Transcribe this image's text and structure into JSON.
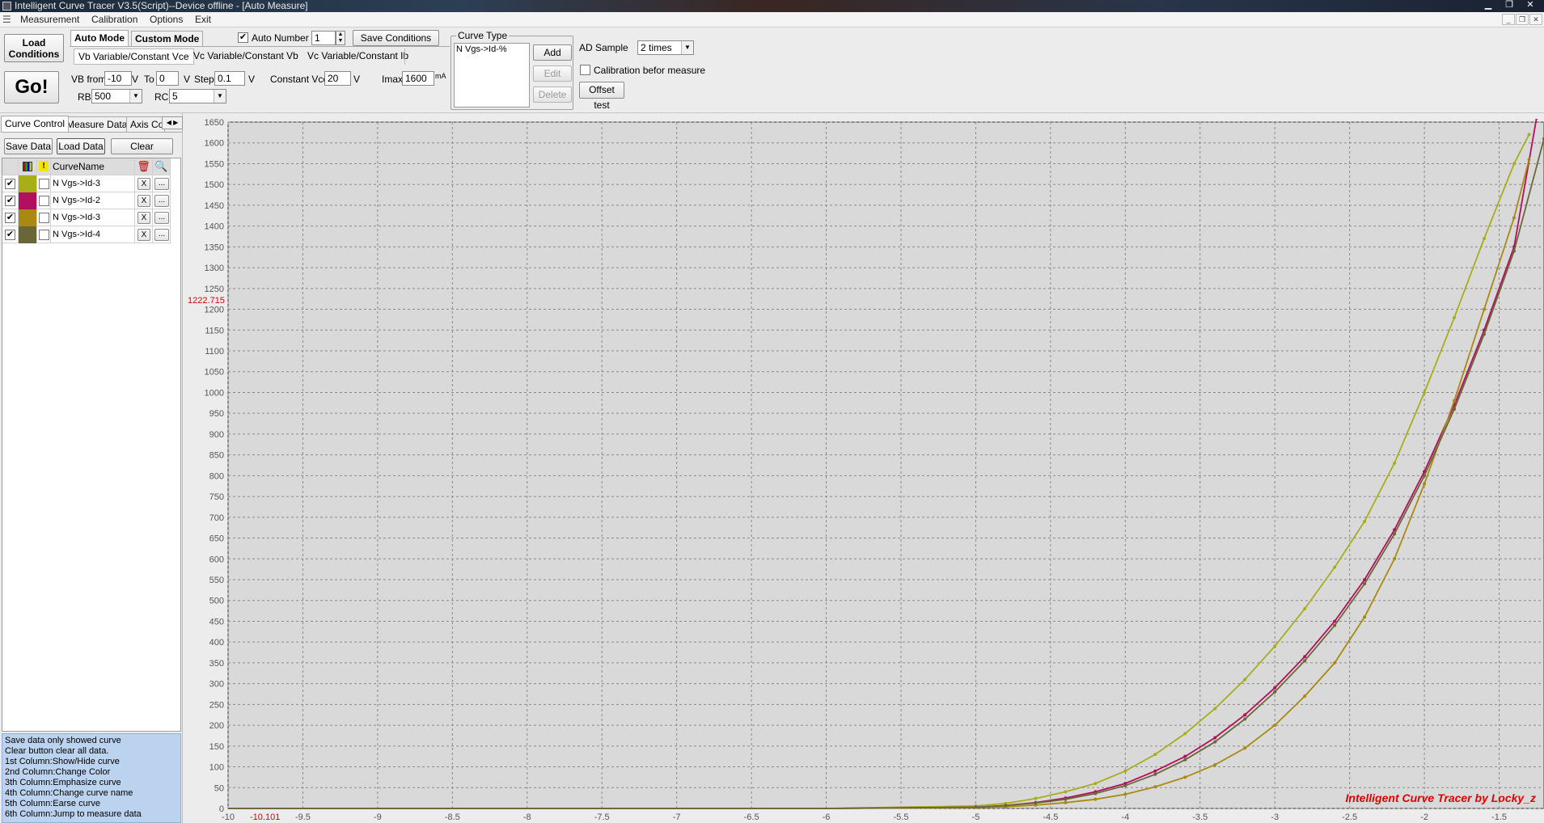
{
  "window": {
    "title": "Intelligent Curve Tracer V3.5(Script)--Device offline - [Auto Measure]"
  },
  "menu": [
    "Measurement",
    "Calibration",
    "Options",
    "Exit"
  ],
  "toolbar": {
    "load_conditions": "Load Conditions",
    "go": "Go!",
    "mode_tabs": [
      "Auto Mode",
      "Custom Mode"
    ],
    "auto_number_label": "Auto Number",
    "auto_number_checked": true,
    "auto_number_value": "1",
    "save_conditions": "Save Conditions",
    "sub_tabs": [
      "Vb Variable/Constant Vce",
      "Vc Variable/Constant Vb",
      "Vc Variable/Constant Ib"
    ],
    "vb_from_label": "VB from",
    "vb_from": "-10",
    "v1": "V",
    "to_label": "To",
    "to": "0",
    "v2": "V",
    "step_label": "Step",
    "step": "0.1",
    "v3": "V",
    "constant_vce_label": "Constant Vce",
    "constant_vce": "20",
    "v4": "V",
    "imax_label": "Imax",
    "imax": "1600",
    "imax_unit": "mA",
    "rb_label": "RB",
    "rb": "500",
    "rc_label": "RC",
    "rc": "5"
  },
  "curve_type": {
    "legend": "Curve Type",
    "items": [
      "N Vgs->Id-%"
    ],
    "add": "Add",
    "edit": "Edit",
    "delete": "Delete"
  },
  "ad_sample": {
    "label": "AD Sample",
    "value": "2 times",
    "calibration_label": "Calibration befor measure",
    "calibration_checked": false,
    "offset_test": "Offset test"
  },
  "left_tabs": [
    "Curve Control",
    "Measure Data",
    "Axis Co"
  ],
  "left_buttons": {
    "save": "Save Data",
    "load": "Load Data",
    "clear": "Clear"
  },
  "curve_table": {
    "header": "CurveName",
    "rows": [
      {
        "visible": true,
        "color": "#a8ad1a",
        "emphasize": false,
        "name": "N Vgs->Id-3"
      },
      {
        "visible": true,
        "color": "#b0105e",
        "emphasize": false,
        "name": "N Vgs->Id-2"
      },
      {
        "visible": true,
        "color": "#a88a12",
        "emphasize": false,
        "name": "N Vgs->Id-3"
      },
      {
        "visible": true,
        "color": "#6b6638",
        "emphasize": false,
        "name": "N Vgs->Id-4"
      }
    ],
    "erase": "X",
    "more": "..."
  },
  "help_text": [
    " Save data only showed curve",
    " Clear button clear all data.",
    "1st Column:Show/Hide curve",
    "2nd Column:Change Color",
    "3th Column:Emphasize curve",
    "4th Column:Change curve name",
    "5th Column:Earse curve",
    "6th Column:Jump to measure data"
  ],
  "chart_data": {
    "type": "line",
    "xlabel": "",
    "ylabel": "",
    "xlim": [
      -10,
      -1.2
    ],
    "ylim": [
      0,
      1650
    ],
    "x_ticks": [
      -10,
      -9.5,
      -9,
      -8.5,
      -8,
      -7.5,
      -7,
      -6.5,
      -6,
      -5.5,
      -5,
      -4.5,
      -4,
      -3.5,
      -3,
      -2.5,
      -2,
      -1.5
    ],
    "y_ticks": [
      0,
      50,
      100,
      150,
      200,
      250,
      300,
      350,
      400,
      450,
      500,
      550,
      600,
      650,
      700,
      750,
      800,
      850,
      900,
      950,
      1000,
      1050,
      1100,
      1150,
      1200,
      1250,
      1300,
      1350,
      1400,
      1450,
      1500,
      1550,
      1600,
      1650
    ],
    "grid": true,
    "cursor_y_label": "1222.715",
    "cursor_x_label": "-10.101",
    "watermark": "Intelligent Curve Tracer by Locky_z",
    "series": [
      {
        "color": "#a8ad1a",
        "x": [
          -10,
          -6,
          -5,
          -4.8,
          -4.6,
          -4.4,
          -4.2,
          -4.0,
          -3.8,
          -3.6,
          -3.4,
          -3.2,
          -3.0,
          -2.8,
          -2.6,
          -2.4,
          -2.2,
          -2.0,
          -1.8,
          -1.6,
          -1.4,
          -1.3
        ],
        "y": [
          0,
          0,
          6,
          12,
          24,
          40,
          60,
          90,
          130,
          180,
          240,
          310,
          390,
          480,
          580,
          690,
          830,
          1000,
          1180,
          1370,
          1550,
          1620
        ]
      },
      {
        "color": "#b0105e",
        "x": [
          -10,
          -6,
          -5,
          -4.8,
          -4.6,
          -4.4,
          -4.2,
          -4.0,
          -3.8,
          -3.6,
          -3.4,
          -3.2,
          -3.0,
          -2.8,
          -2.6,
          -2.4,
          -2.2,
          -2.0,
          -1.8,
          -1.6,
          -1.4,
          -1.25
        ],
        "y": [
          0,
          0,
          3,
          7,
          14,
          25,
          40,
          60,
          90,
          125,
          170,
          225,
          290,
          365,
          450,
          550,
          670,
          810,
          970,
          1150,
          1350,
          1660
        ]
      },
      {
        "color": "#a88a12",
        "x": [
          -10,
          -6,
          -5,
          -4.8,
          -4.6,
          -4.4,
          -4.2,
          -4.0,
          -3.8,
          -3.6,
          -3.4,
          -3.2,
          -3.0,
          -2.8,
          -2.6,
          -2.4,
          -2.2,
          -2.0,
          -1.8,
          -1.6,
          -1.4,
          -1.3
        ],
        "y": [
          0,
          0,
          2,
          4,
          8,
          14,
          22,
          34,
          52,
          75,
          105,
          145,
          200,
          270,
          350,
          460,
          600,
          780,
          980,
          1200,
          1420,
          1560
        ]
      },
      {
        "color": "#6b6638",
        "x": [
          -10,
          -6,
          -5,
          -4.8,
          -4.6,
          -4.4,
          -4.2,
          -4.0,
          -3.8,
          -3.6,
          -3.4,
          -3.2,
          -3.0,
          -2.8,
          -2.6,
          -2.4,
          -2.2,
          -2.0,
          -1.8,
          -1.6,
          -1.4,
          -1.2
        ],
        "y": [
          0,
          0,
          3,
          7,
          13,
          22,
          36,
          55,
          82,
          117,
          160,
          215,
          280,
          355,
          440,
          540,
          660,
          800,
          960,
          1140,
          1340,
          1610
        ]
      }
    ]
  }
}
